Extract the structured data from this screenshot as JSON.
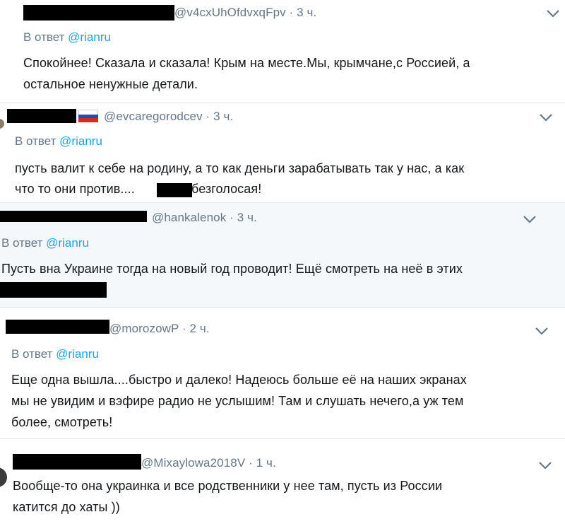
{
  "tweets": [
    {
      "handle": "@v4cxUhOfdvxqFpv · 3 ч.",
      "reply_prefix": "В ответ ",
      "reply_mention": "@rianru",
      "lines": [
        "Спокойнее! Сказала и сказала! Крым на месте.Мы, крымчане,с Россией, а",
        "остальное ненужные детали."
      ]
    },
    {
      "handle": "@evcaregorodcev · 3 ч.",
      "reply_prefix": "В ответ ",
      "reply_mention": "@rianru",
      "lines": [
        "пусть валит к себе на родину, а то как деньги зарабатывать так у нас, а как",
        "что то они против....",
        "безголосая!"
      ]
    },
    {
      "handle": "@hankalenok · 3 ч.",
      "reply_prefix": "В ответ ",
      "reply_mention": "@rianru",
      "lines": [
        "Пусть вна Украине тогда на новый год проводит! Ещё смотреть на неё в этих"
      ]
    },
    {
      "handle": "@morozowP · 2 ч.",
      "reply_prefix": "В ответ ",
      "reply_mention": "@rianru",
      "lines": [
        "Еще одна вышла....быстро и далеко! Надеюсь больше её на наших экранах",
        "мы не увидим и вэфире радио не услышим! Там и слушать нечего,а уж тем",
        "более, смотреть!"
      ]
    },
    {
      "handle": "@Mixaylowa2018V · 1 ч.",
      "lines": [
        "Вообще-то она украинка и все родственники у нее там, пусть из России",
        "катится до хаты ))"
      ]
    }
  ],
  "icons": {
    "menu": "chevron-down-icon",
    "flag": "russia-flag-icon"
  },
  "colors": {
    "muted": "#657786",
    "link": "#1da1f2",
    "divider": "#e1e8ed",
    "redaction": "#000000"
  }
}
